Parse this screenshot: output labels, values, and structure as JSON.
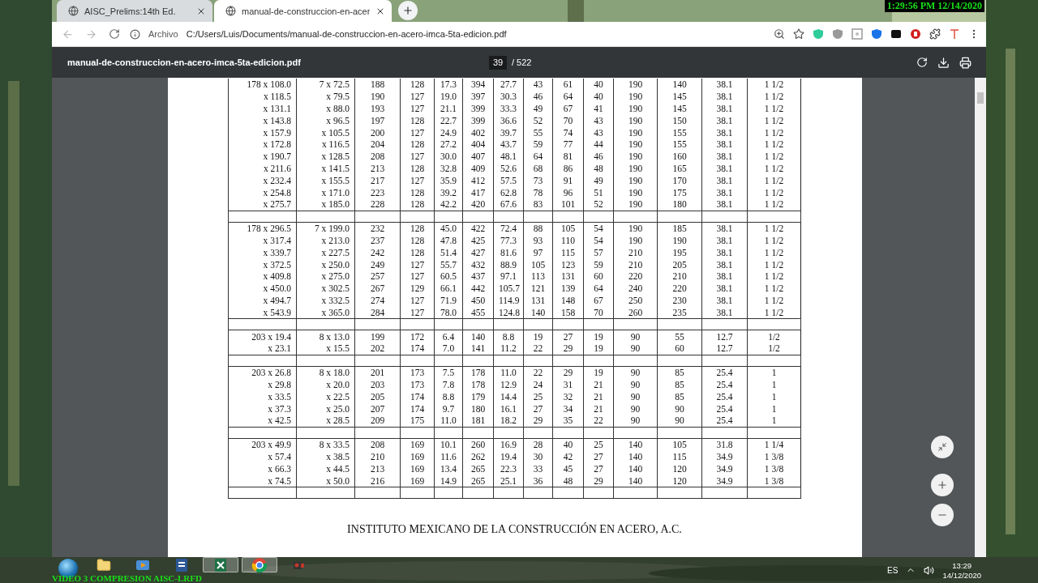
{
  "overlay": {
    "timestamp": "1:29:56 PM 12/14/2020",
    "caption": "VIDEO 3 COMPRESION AISC-LRFD"
  },
  "tabs": [
    {
      "title": "AISC_Prelims:14th Ed.",
      "selected": false
    },
    {
      "title": "manual-de-construccion-en-acer",
      "selected": true
    }
  ],
  "address_bar": {
    "scheme_label": "Archivo",
    "url": "C:/Users/Luis/Documents/manual-de-construccion-en-acero-imca-5ta-edicion.pdf"
  },
  "pdf_toolbar": {
    "filename": "manual-de-construccion-en-acero-imca-5ta-edicion.pdf",
    "page": "39",
    "total": "/ 522"
  },
  "table": {
    "groups": [
      {
        "rows": [
          [
            "178 x 108.0",
            "7 x 72.5",
            "188",
            "128",
            "17.3",
            "394",
            "27.7",
            "43",
            "61",
            "40",
            "190",
            "140",
            "38.1",
            "1 1/2"
          ],
          [
            "x 118.5",
            "x 79.5",
            "190",
            "127",
            "19.0",
            "397",
            "30.3",
            "46",
            "64",
            "40",
            "190",
            "145",
            "38.1",
            "1 1/2"
          ],
          [
            "x 131.1",
            "x 88.0",
            "193",
            "127",
            "21.1",
            "399",
            "33.3",
            "49",
            "67",
            "41",
            "190",
            "145",
            "38.1",
            "1 1/2"
          ],
          [
            "x 143.8",
            "x 96.5",
            "197",
            "128",
            "22.7",
            "399",
            "36.6",
            "52",
            "70",
            "43",
            "190",
            "150",
            "38.1",
            "1 1/2"
          ],
          [
            "x 157.9",
            "x 105.5",
            "200",
            "127",
            "24.9",
            "402",
            "39.7",
            "55",
            "74",
            "43",
            "190",
            "155",
            "38.1",
            "1 1/2"
          ],
          [
            "x 172.8",
            "x 116.5",
            "204",
            "128",
            "27.2",
            "404",
            "43.7",
            "59",
            "77",
            "44",
            "190",
            "155",
            "38.1",
            "1 1/2"
          ],
          [
            "x 190.7",
            "x 128.5",
            "208",
            "127",
            "30.0",
            "407",
            "48.1",
            "64",
            "81",
            "46",
            "190",
            "160",
            "38.1",
            "1 1/2"
          ],
          [
            "x 211.6",
            "x 141.5",
            "213",
            "128",
            "32.8",
            "409",
            "52.6",
            "68",
            "86",
            "48",
            "190",
            "165",
            "38.1",
            "1 1/2"
          ],
          [
            "x 232.4",
            "x 155.5",
            "217",
            "127",
            "35.9",
            "412",
            "57.5",
            "73",
            "91",
            "49",
            "190",
            "170",
            "38.1",
            "1 1/2"
          ],
          [
            "x 254.8",
            "x 171.0",
            "223",
            "128",
            "39.2",
            "417",
            "62.8",
            "78",
            "96",
            "51",
            "190",
            "175",
            "38.1",
            "1 1/2"
          ],
          [
            "x 275.7",
            "x 185.0",
            "228",
            "128",
            "42.2",
            "420",
            "67.6",
            "83",
            "101",
            "52",
            "190",
            "180",
            "38.1",
            "1 1/2"
          ]
        ]
      },
      {
        "rows": [
          [
            "178 x 296.5",
            "7 x 199.0",
            "232",
            "128",
            "45.0",
            "422",
            "72.4",
            "88",
            "105",
            "54",
            "190",
            "185",
            "38.1",
            "1 1/2"
          ],
          [
            "x 317.4",
            "x 213.0",
            "237",
            "128",
            "47.8",
            "425",
            "77.3",
            "93",
            "110",
            "54",
            "190",
            "190",
            "38.1",
            "1 1/2"
          ],
          [
            "x 339.7",
            "x 227.5",
            "242",
            "128",
            "51.4",
            "427",
            "81.6",
            "97",
            "115",
            "57",
            "210",
            "195",
            "38.1",
            "1 1/2"
          ],
          [
            "x 372.5",
            "x 250.0",
            "249",
            "127",
            "55.7",
            "432",
            "88.9",
            "105",
            "123",
            "59",
            "210",
            "205",
            "38.1",
            "1 1/2"
          ],
          [
            "x 409.8",
            "x 275.0",
            "257",
            "127",
            "60.5",
            "437",
            "97.1",
            "113",
            "131",
            "60",
            "220",
            "210",
            "38.1",
            "1 1/2"
          ],
          [
            "x 450.0",
            "x 302.5",
            "267",
            "129",
            "66.1",
            "442",
            "105.7",
            "121",
            "139",
            "64",
            "240",
            "220",
            "38.1",
            "1 1/2"
          ],
          [
            "x 494.7",
            "x 332.5",
            "274",
            "127",
            "71.9",
            "450",
            "114.9",
            "131",
            "148",
            "67",
            "250",
            "230",
            "38.1",
            "1 1/2"
          ],
          [
            "x 543.9",
            "x 365.0",
            "284",
            "127",
            "78.0",
            "455",
            "124.8",
            "140",
            "158",
            "70",
            "260",
            "235",
            "38.1",
            "1 1/2"
          ]
        ]
      },
      {
        "rows": [
          [
            "203 x 19.4",
            "8 x 13.0",
            "199",
            "172",
            "6.4",
            "140",
            "8.8",
            "19",
            "27",
            "19",
            "90",
            "55",
            "12.7",
            "1/2"
          ],
          [
            "x 23.1",
            "x 15.5",
            "202",
            "174",
            "7.0",
            "141",
            "11.2",
            "22",
            "29",
            "19",
            "90",
            "60",
            "12.7",
            "1/2"
          ]
        ]
      },
      {
        "rows": [
          [
            "203 x 26.8",
            "8 x 18.0",
            "201",
            "173",
            "7.5",
            "178",
            "11.0",
            "22",
            "29",
            "19",
            "90",
            "85",
            "25.4",
            "1"
          ],
          [
            "x 29.8",
            "x 20.0",
            "203",
            "173",
            "7.8",
            "178",
            "12.9",
            "24",
            "31",
            "21",
            "90",
            "85",
            "25.4",
            "1"
          ],
          [
            "x 33.5",
            "x 22.5",
            "205",
            "174",
            "8.8",
            "179",
            "14.4",
            "25",
            "32",
            "21",
            "90",
            "85",
            "25.4",
            "1"
          ],
          [
            "x 37.3",
            "x 25.0",
            "207",
            "174",
            "9.7",
            "180",
            "16.1",
            "27",
            "34",
            "21",
            "90",
            "90",
            "25.4",
            "1"
          ],
          [
            "x 42.5",
            "x 28.5",
            "209",
            "175",
            "11.0",
            "181",
            "18.2",
            "29",
            "35",
            "22",
            "90",
            "90",
            "25.4",
            "1"
          ]
        ]
      },
      {
        "rows": [
          [
            "203 x 49.9",
            "8 x 33.5",
            "208",
            "169",
            "10.1",
            "260",
            "16.9",
            "28",
            "40",
            "25",
            "140",
            "105",
            "31.8",
            "1 1/4"
          ],
          [
            "x 57.4",
            "x 38.5",
            "210",
            "169",
            "11.6",
            "262",
            "19.4",
            "30",
            "42",
            "27",
            "140",
            "115",
            "34.9",
            "1 3/8"
          ],
          [
            "x 66.3",
            "x 44.5",
            "213",
            "169",
            "13.4",
            "265",
            "22.3",
            "33",
            "45",
            "27",
            "140",
            "120",
            "34.9",
            "1 3/8"
          ],
          [
            "x 74.5",
            "x 50.0",
            "216",
            "169",
            "14.9",
            "265",
            "25.1",
            "36",
            "48",
            "29",
            "140",
            "120",
            "34.9",
            "1 3/8"
          ]
        ]
      }
    ]
  },
  "page_footer": "INSTITUTO MEXICANO DE LA CONSTRUCCIÓN EN ACERO, A.C.",
  "taskbar": {
    "apps": [
      {
        "kind": "folder",
        "active": false
      },
      {
        "kind": "media",
        "active": false
      },
      {
        "kind": "word",
        "active": false
      },
      {
        "kind": "excel",
        "active": true
      },
      {
        "kind": "chrome",
        "active": true
      },
      {
        "kind": "camera",
        "active": false
      }
    ],
    "language": "ES",
    "time": "13:29",
    "date": "14/12/2020"
  }
}
